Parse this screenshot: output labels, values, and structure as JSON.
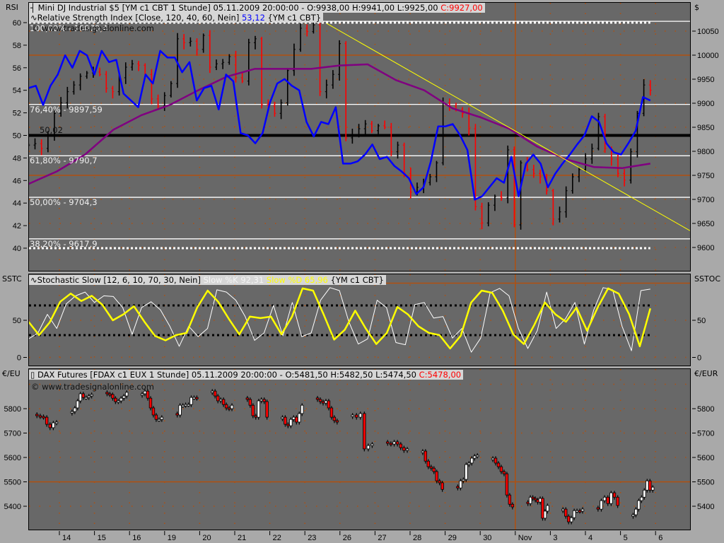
{
  "panels": {
    "price": {
      "left_axis_name": "RSI",
      "right_axis_name": "$",
      "header_icon": "bar-chart-icon",
      "header_text": "Mini DJ Industrial $5 [YM c1 CBT  1 Stunde] 05.11.2009 20:00:00 - O:9938,00 H:9941,00 L:9925,00 ",
      "header_close": "C:9927,00",
      "rsi_icon": "indicator-wave-icon",
      "rsi_text": "Relative Strength Index [Close, 120, 40, 60, Nein] ",
      "rsi_value": "53,12",
      "rsi_symbol": " {YM c1 CBT}",
      "copyright": "© www.tradesignalonline.com",
      "level_label": "50,02",
      "fib_labels": [
        "100,00% - 10070,4",
        "76,40% - 9897,59",
        "61,80% - 9790,7",
        "50,00% - 9704,3",
        "38,20% - 9617,9"
      ]
    },
    "stoch": {
      "left_axis_name": "SSTC",
      "right_axis_name": "SSTOC",
      "icon": "indicator-wave-icon",
      "text": "Stochastic Slow [12, 6, 10, 70, 30, Nein] ",
      "k_label": "Slow %K 92,31",
      "d_label": " Slow %D 65,96",
      "symbol": " {YM c1 CBT}"
    },
    "dax": {
      "left_axis_name": "€/EU",
      "right_axis_name": "€/EUR",
      "icon": "candle-icon",
      "text": "DAX Futures [FDAX c1 EUX  1 Stunde] 05.11.2009 20:00:00 - O:5481,50 H:5482,50 L:5474,50 ",
      "close": "C:5478,00",
      "copyright": "© www.tradesignalonline.com"
    }
  },
  "colors": {
    "panel_bg": "#686868",
    "bar_up": "#000000",
    "bar_down": "#ff0000",
    "rsi": "#0000ff",
    "rsi_sma": "#800080",
    "trendline": "#ffff00",
    "stoch_k": "#ffffff",
    "stoch_d": "#ffff00",
    "grid": "#b05010",
    "fib": "#ffffff"
  },
  "chart_data": [
    {
      "type": "line",
      "title": "Mini DJ Industrial $5 [YM c1 CBT 1 Stunde] with Relative Strength Index",
      "x_axis": {
        "unit": "trading day index (0 = Oct 14, 2009)",
        "tick_labels": [
          "14",
          "15",
          "16",
          "19",
          "20",
          "21",
          "22",
          "23",
          "26",
          "27",
          "28",
          "29",
          "30",
          "Nov",
          "3",
          "4",
          "5",
          "6"
        ],
        "range": [
          -0.9,
          18.0
        ],
        "series_span": [
          -0.88,
          16.85
        ],
        "separator_day": 13
      },
      "price_axis": {
        "ticks": [
          9600,
          9650,
          9700,
          9750,
          9800,
          9850,
          9900,
          9950,
          10000,
          10050
        ],
        "highlight": [
          10000,
          9750
        ]
      },
      "rsi_axis": {
        "ticks": [
          40,
          42,
          44,
          46,
          48,
          50,
          52,
          54,
          56,
          58,
          60
        ],
        "levels": [
          60,
          50,
          40
        ]
      },
      "fib_levels": [
        10070.4,
        9897.59,
        9790.7,
        9704.3,
        9617.9
      ],
      "trendline": {
        "start": {
          "day": 7.62,
          "price": 10066
        },
        "end": {
          "day": 17.98,
          "price": 9635
        }
      },
      "price_closes": [
        9813,
        9816,
        9806,
        9835,
        9879,
        9901,
        9924,
        9938,
        9956,
        9963,
        9965,
        9960,
        9931,
        9924,
        9953,
        9975,
        9982,
        9979,
        9960,
        9909,
        9894,
        9916,
        9941,
        10034,
        10026,
        10029,
        10012,
        10041,
        9975,
        9982,
        9985,
        9997,
        9953,
        9946,
        10026,
        10034,
        9897,
        9894,
        9879,
        9901,
        9968,
        10012,
        10056,
        10049,
        10063,
        9924,
        9938,
        9960,
        10024,
        9828,
        9835,
        9847,
        9857,
        9843,
        9853,
        9850,
        9799,
        9813,
        9754,
        9715,
        9725,
        9735,
        9747,
        9776,
        9901,
        9894,
        9887,
        9879,
        9847,
        9685,
        9651,
        9688,
        9706,
        9703,
        9803,
        9647,
        9776,
        9762,
        9754,
        9747,
        9718,
        9659,
        9674,
        9718,
        9747,
        9762,
        9784,
        9806,
        9872,
        9806,
        9784,
        9754,
        9740,
        9799,
        9879,
        9938,
        9927
      ],
      "rsi": [
        54.2,
        54.4,
        52.7,
        54.4,
        55.4,
        57.1,
        56.0,
        57.5,
        57.1,
        55.4,
        57.5,
        56.5,
        56.7,
        53.7,
        53.1,
        52.5,
        55.4,
        54.6,
        57.5,
        56.9,
        56.9,
        55.6,
        56.5,
        53.1,
        54.2,
        54.4,
        52.3,
        55.4,
        54.8,
        50.2,
        50.0,
        49.3,
        50.2,
        52.9,
        54.6,
        55.0,
        54.4,
        54.0,
        51.2,
        49.9,
        51.2,
        51.0,
        52.5,
        47.5,
        47.5,
        47.7,
        48.3,
        49.2,
        47.9,
        48.1,
        47.3,
        46.8,
        46.2,
        44.8,
        45.4,
        47.7,
        50.8,
        50.8,
        51.0,
        50.0,
        48.7,
        44.3,
        44.6,
        45.4,
        46.2,
        45.8,
        48.1,
        44.6,
        47.5,
        48.3,
        47.5,
        45.4,
        46.6,
        47.5,
        48.3,
        49.2,
        50.0,
        51.7,
        51.2,
        49.3,
        48.5,
        48.3,
        49.3,
        50.4,
        53.4,
        53.1
      ],
      "rsi_sma": [
        45.7,
        46.8,
        48.3,
        50.5,
        51.8,
        52.7,
        54.0,
        55.2,
        55.9,
        55.9,
        55.9,
        56.2,
        56.3,
        54.9,
        54.0,
        52.4,
        51.6,
        50.6,
        49.0,
        47.9,
        47.2,
        47.1,
        47.5
      ]
    },
    {
      "type": "line",
      "title": "Stochastic Slow [12, 6, 10, 70, 30, Nein]",
      "y_axis": {
        "ticks": [
          0,
          50
        ],
        "levels": [
          70,
          30
        ],
        "range": [
          0,
          100
        ]
      },
      "k": [
        25,
        33,
        58,
        39,
        72,
        83,
        88,
        74,
        83,
        82,
        67,
        31,
        67,
        75,
        64,
        42,
        15,
        42,
        28,
        39,
        91,
        88,
        77,
        55,
        23,
        33,
        70,
        29,
        74,
        28,
        33,
        77,
        94,
        90,
        48,
        18,
        25,
        77,
        67,
        20,
        17,
        71,
        74,
        53,
        55,
        26,
        39,
        7,
        26,
        87,
        93,
        83,
        39,
        12,
        36,
        88,
        39,
        52,
        74,
        18,
        64,
        94,
        91,
        42,
        9,
        90,
        92
      ],
      "d": [
        48,
        30,
        47,
        75,
        86,
        76,
        83,
        71,
        50,
        58,
        69,
        48,
        29,
        23,
        30,
        33,
        67,
        90,
        75,
        52,
        31,
        55,
        53,
        55,
        31,
        55,
        93,
        90,
        58,
        24,
        37,
        63,
        39,
        18,
        33,
        68,
        58,
        42,
        33,
        30,
        12,
        29,
        74,
        90,
        87,
        63,
        31,
        18,
        44,
        74,
        58,
        48,
        67,
        36,
        67,
        93,
        86,
        58,
        15,
        66
      ]
    },
    {
      "type": "candlestick",
      "title": "DAX Futures [FDAX c1 EUX 1 Stunde]",
      "y_axis": {
        "ticks": [
          5400,
          5500,
          5600,
          5700,
          5800
        ],
        "highlight": [
          5500
        ]
      },
      "sessions": [
        {
          "day": -1,
          "closes": [
            5771,
            5768,
            5765,
            5736,
            5722,
            5742,
            5745
          ]
        },
        {
          "day": 0,
          "closes": [
            5788,
            5803,
            5832,
            5861,
            5846,
            5846,
            5852,
            5858
          ]
        },
        {
          "day": 1,
          "closes": [
            5861,
            5858,
            5843,
            5829,
            5832,
            5843,
            5852,
            5867
          ]
        },
        {
          "day": 2,
          "closes": [
            5861,
            5872,
            5843,
            5803,
            5774,
            5756,
            5756,
            5765
          ]
        },
        {
          "day": 3,
          "closes": [
            5774,
            5814,
            5814,
            5817,
            5817,
            5846,
            5846,
            5843
          ]
        },
        {
          "day": 4,
          "closes": [
            5872,
            5852,
            5832,
            5838,
            5817,
            5803,
            5800,
            5814
          ]
        },
        {
          "day": 5,
          "closes": [
            5838,
            5814,
            5771,
            5765,
            5832,
            5838,
            5829,
            5765
          ]
        },
        {
          "day": 6,
          "closes": [
            5765,
            5736,
            5730,
            5756,
            5765,
            5745,
            5780,
            5814
          ]
        },
        {
          "day": 7,
          "closes": [
            5838,
            5829,
            5823,
            5832,
            5803,
            5765,
            5751,
            5745
          ]
        },
        {
          "day": 8,
          "closes": [
            5774,
            5765,
            5780,
            5635,
            5649,
            5655
          ]
        },
        {
          "day": 9,
          "closes": [
            5658,
            5655,
            5664,
            5655,
            5640,
            5629,
            5635
          ]
        },
        {
          "day": 10,
          "closes": [
            5626,
            5585,
            5562,
            5556,
            5542,
            5504,
            5496,
            5469
          ]
        },
        {
          "day": 11,
          "closes": [
            5475,
            5504,
            5510,
            5571,
            5577,
            5597,
            5606,
            5609
          ]
        },
        {
          "day": 12,
          "closes": [
            5597,
            5577,
            5562,
            5542,
            5533,
            5446,
            5408,
            5397
          ]
        },
        {
          "day": 13,
          "closes": [
            5411,
            5437,
            5432,
            5426,
            5417,
            5432,
            5351,
            5380,
            5403
          ]
        },
        {
          "day": 14,
          "closes": [
            5388,
            5359,
            5336,
            5353,
            5382,
            5382,
            5380,
            5388
          ]
        },
        {
          "day": 15,
          "closes": [
            5388,
            5423,
            5437,
            5411,
            5455,
            5437,
            5403
          ]
        },
        {
          "day": 16,
          "closes": [
            5365,
            5388,
            5423,
            5437,
            5466,
            5504,
            5466,
            5478
          ]
        }
      ]
    }
  ]
}
